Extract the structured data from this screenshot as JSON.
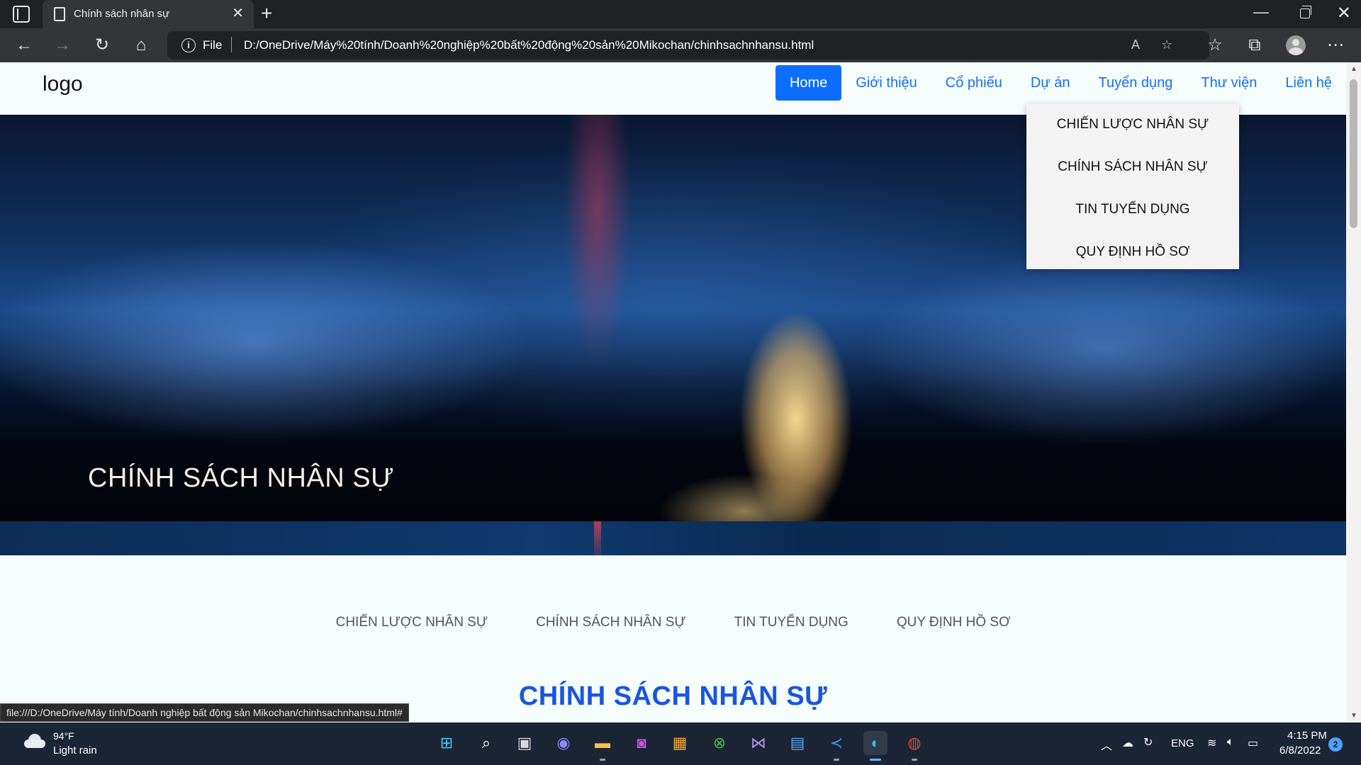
{
  "browser": {
    "tab_title": "Chính sách nhân sự",
    "address_scheme": "File",
    "address_url": "D:/OneDrive/Máy%20tính/Doanh%20nghiệp%20bất%20động%20sản%20Mikochan/chinhsachnhansu.html",
    "status_link": "file:///D:/OneDrive/Máy tính/Doanh nghiệp bất động sản Mikochan/chinhsachnhansu.html#"
  },
  "site": {
    "logo": "logo",
    "nav": [
      {
        "label": "Home"
      },
      {
        "label": "Giới thiệu"
      },
      {
        "label": "Cổ phiếu"
      },
      {
        "label": "Dự án"
      },
      {
        "label": "Tuyển dụng"
      },
      {
        "label": "Thư viện"
      },
      {
        "label": "Liên hệ"
      }
    ],
    "dropdown": [
      {
        "label": "CHIẾN LƯỢC NHÂN SỰ"
      },
      {
        "label": "CHÍNH SÁCH NHÂN SỰ"
      },
      {
        "label": "TIN TUYỂN DỤNG"
      },
      {
        "label": "QUY ĐỊNH HỒ SƠ"
      }
    ],
    "hero_title": "CHÍNH SÁCH NHÂN SỰ",
    "subnav": [
      {
        "label": "CHIẾN LƯỢC NHÂN SỰ"
      },
      {
        "label": "CHÍNH SÁCH NHÂN SỰ"
      },
      {
        "label": "TIN TUYỂN DỤNG"
      },
      {
        "label": "QUY ĐỊNH HỒ SƠ"
      }
    ],
    "section_title": "CHÍNH SÁCH NHÂN SỰ"
  },
  "taskbar": {
    "weather_temp": "94°F",
    "weather_desc": "Light rain",
    "language": "ENG",
    "time": "4:15 PM",
    "date": "6/8/2022",
    "notifications": "2",
    "apps": [
      "start",
      "search",
      "task-view",
      "teams-chat",
      "file-explorer",
      "photo-app",
      "store",
      "xbox",
      "visual-studio",
      "remote-app",
      "vscode",
      "edge",
      "chrome"
    ]
  },
  "colors": {
    "accent": "#0d6efd",
    "link": "#1a6ef5",
    "section_title": "#1a55e0"
  }
}
